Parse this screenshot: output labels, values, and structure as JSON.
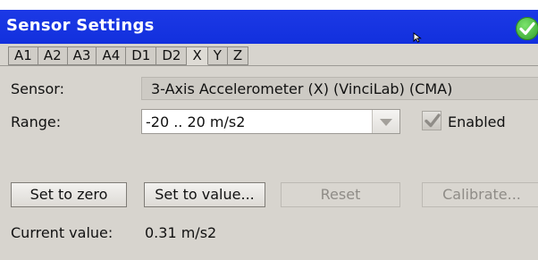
{
  "window": {
    "title": "Sensor Settings"
  },
  "icons": {
    "confirm": "checkmark-icon",
    "cursor": "mouse-pointer-icon",
    "dropdown": "triangle-down-icon",
    "check": "checkmark-icon"
  },
  "colors": {
    "titlebar": "#1a35e3",
    "confirm_green": "#3aa835",
    "panel": "#d7d4ce"
  },
  "tabs": [
    {
      "label": "A1",
      "active": false
    },
    {
      "label": "A2",
      "active": false
    },
    {
      "label": "A3",
      "active": false
    },
    {
      "label": "A4",
      "active": false
    },
    {
      "label": "D1",
      "active": false
    },
    {
      "label": "D2",
      "active": false
    },
    {
      "label": "X",
      "active": true
    },
    {
      "label": "Y",
      "active": false
    },
    {
      "label": "Z",
      "active": false
    }
  ],
  "form": {
    "sensor_label": "Sensor:",
    "sensor_value": "3-Axis Accelerometer (X) (VinciLab) (CMA)",
    "range_label": "Range:",
    "range_value": "-20 .. 20 m/s2",
    "enabled_label": "Enabled",
    "enabled_checked": true
  },
  "buttons": {
    "set_zero": "Set to zero",
    "set_value": "Set to value...",
    "reset": "Reset",
    "calibrate": "Calibrate..."
  },
  "current": {
    "label": "Current value:",
    "value": "0.31 m/s2"
  }
}
